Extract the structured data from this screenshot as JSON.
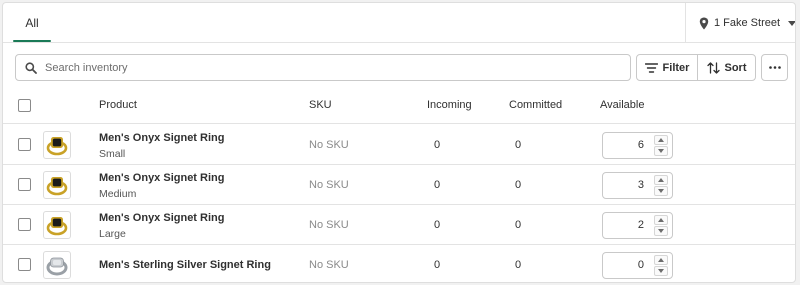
{
  "tabs": [
    {
      "label": "All"
    }
  ],
  "location": {
    "label": "1 Fake Street"
  },
  "search": {
    "placeholder": "Search inventory"
  },
  "toolbar": {
    "filter_label": "Filter",
    "sort_label": "Sort"
  },
  "table": {
    "headers": {
      "product": "Product",
      "sku": "SKU",
      "incoming": "Incoming",
      "committed": "Committed",
      "available": "Available"
    },
    "rows": [
      {
        "name": "Men's Onyx Signet Ring",
        "variant": "Small",
        "sku": "No SKU",
        "incoming": "0",
        "committed": "0",
        "available": "6",
        "image": "gold-onyx-ring"
      },
      {
        "name": "Men's Onyx Signet Ring",
        "variant": "Medium",
        "sku": "No SKU",
        "incoming": "0",
        "committed": "0",
        "available": "3",
        "image": "gold-onyx-ring"
      },
      {
        "name": "Men's Onyx Signet Ring",
        "variant": "Large",
        "sku": "No SKU",
        "incoming": "0",
        "committed": "0",
        "available": "2",
        "image": "gold-onyx-ring"
      },
      {
        "name": "Men's Sterling Silver Signet Ring",
        "variant": "",
        "sku": "No SKU",
        "incoming": "0",
        "committed": "0",
        "available": "0",
        "image": "silver-ring"
      }
    ]
  },
  "colors": {
    "accent": "#1a7a57",
    "border": "#c9c9c9",
    "gold": "#c9a227",
    "onyx": "#1b1b1b",
    "silver": "#b8bcc0"
  },
  "icons": {
    "location": "map-pin-icon",
    "search": "search-icon",
    "filter": "filter-icon",
    "sort": "sort-icon",
    "more": "more-horizontal-icon"
  }
}
